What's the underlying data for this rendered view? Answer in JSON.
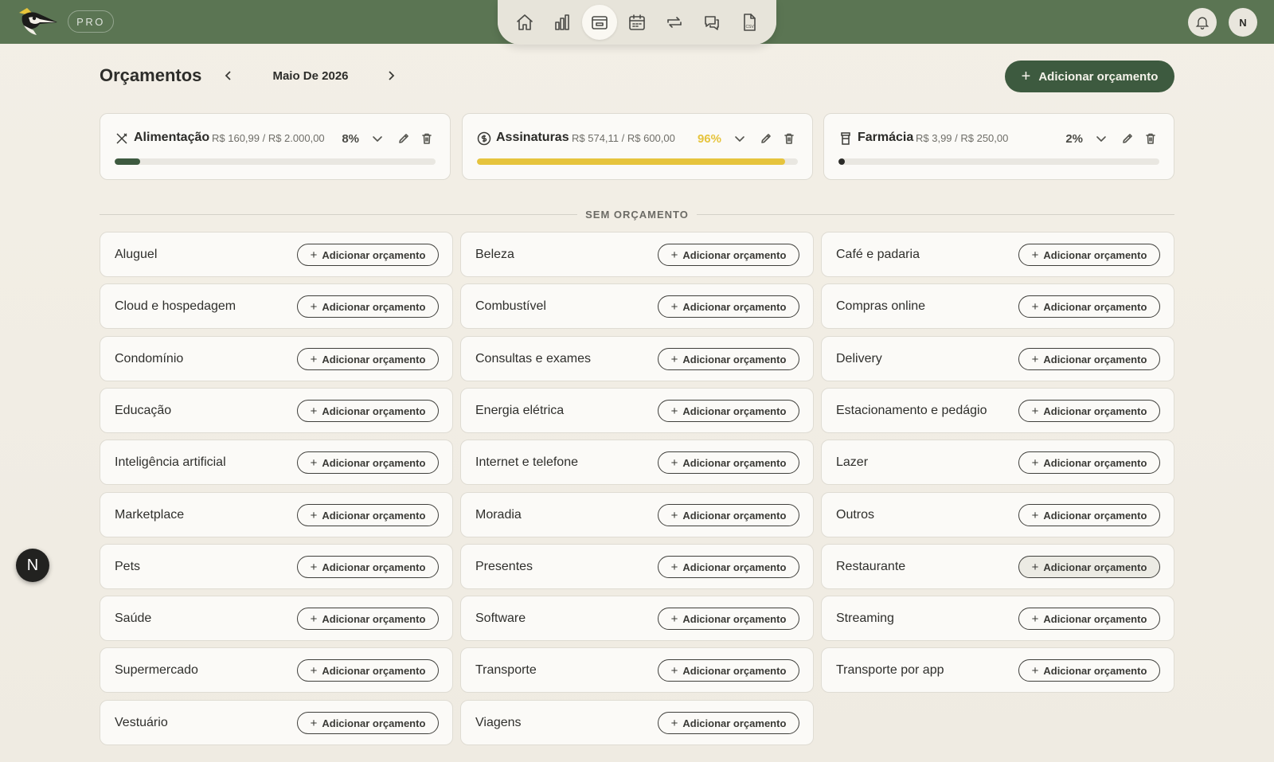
{
  "header": {
    "plan_badge": "PRO",
    "nav": [
      {
        "name": "home-icon",
        "label": "Início"
      },
      {
        "name": "chart-icon",
        "label": "Relatórios"
      },
      {
        "name": "wallet-icon",
        "label": "Orçamentos",
        "active": true
      },
      {
        "name": "calendar-icon",
        "label": "Calendário"
      },
      {
        "name": "transfer-icon",
        "label": "Transações"
      },
      {
        "name": "chat-icon",
        "label": "Chat"
      },
      {
        "name": "csv-icon",
        "label": "CSV"
      }
    ],
    "avatar_initial": "N"
  },
  "page": {
    "title": "Orçamentos",
    "month": "Maio De 2026",
    "add_button": "Adicionar orçamento"
  },
  "budgets": [
    {
      "name": "Alimentação",
      "icon": "utensils-icon",
      "amount": "R$ 160,99 / R$ 2.000,00",
      "percent": "8%",
      "progress": 0.08,
      "color": "#3d5a3f"
    },
    {
      "name": "Assinaturas",
      "icon": "dollar-circle-icon",
      "amount": "R$ 574,11 / R$ 600,00",
      "percent": "96%",
      "progress": 0.96,
      "color": "#e6c43d"
    },
    {
      "name": "Farmácia",
      "icon": "pill-bottle-icon",
      "amount": "R$ 3,99 / R$ 250,00",
      "percent": "2%",
      "progress": 0.02,
      "color": "#2b2b28"
    }
  ],
  "unbudgeted": {
    "label": "SEM ORÇAMENTO",
    "button_label": "Adicionar orçamento",
    "categories": [
      "Aluguel",
      "Beleza",
      "Café e padaria",
      "Cloud e hospedagem",
      "Combustível",
      "Compras online",
      "Condomínio",
      "Consultas e exames",
      "Delivery",
      "Educação",
      "Energia elétrica",
      "Estacionamento e pedágio",
      "Inteligência artificial",
      "Internet e telefone",
      "Lazer",
      "Marketplace",
      "Moradia",
      "Outros",
      "Pets",
      "Presentes",
      "Restaurante",
      "Saúde",
      "Software",
      "Streaming",
      "Supermercado",
      "Transporte",
      "Transporte por app",
      "Vestuário",
      "Viagens"
    ]
  },
  "floating_badge": "N"
}
